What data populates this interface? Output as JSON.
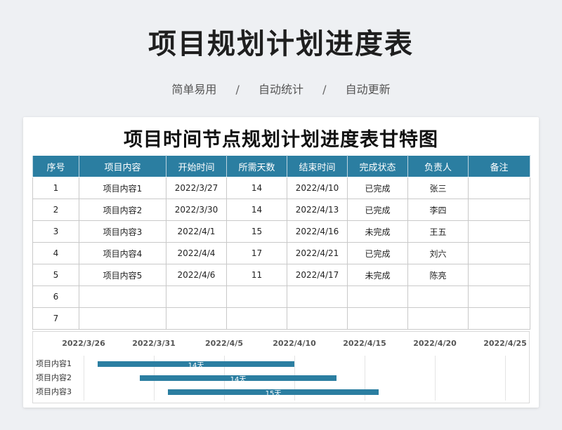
{
  "title": "项目规划计划进度表",
  "subtitle": [
    "简单易用",
    "自动统计",
    "自动更新"
  ],
  "separator": "/",
  "card_title": "项目时间节点规划计划进度表甘特图",
  "table": {
    "headers": [
      "序号",
      "项目内容",
      "开始时间",
      "所需天数",
      "结束时间",
      "完成状态",
      "负责人",
      "备注"
    ],
    "rows": [
      [
        "1",
        "项目内容1",
        "2022/3/27",
        "14",
        "2022/4/10",
        "已完成",
        "张三",
        ""
      ],
      [
        "2",
        "项目内容2",
        "2022/3/30",
        "14",
        "2022/4/13",
        "已完成",
        "李四",
        ""
      ],
      [
        "3",
        "项目内容3",
        "2022/4/1",
        "15",
        "2022/4/16",
        "未完成",
        "王五",
        ""
      ],
      [
        "4",
        "项目内容4",
        "2022/4/4",
        "17",
        "2022/4/21",
        "已完成",
        "刘六",
        ""
      ],
      [
        "5",
        "项目内容5",
        "2022/4/6",
        "11",
        "2022/4/17",
        "未完成",
        "陈亮",
        ""
      ],
      [
        "6",
        "",
        "",
        "",
        "",
        "",
        "",
        ""
      ],
      [
        "7",
        "",
        "",
        "",
        "",
        "",
        "",
        ""
      ]
    ]
  },
  "gantt": {
    "axis_dates": [
      "2022/3/26",
      "2022/3/31",
      "2022/4/5",
      "2022/4/10",
      "2022/4/15",
      "2022/4/20",
      "2022/4/25"
    ],
    "tasks": [
      {
        "name": "项目内容1",
        "start": "2022/3/27",
        "end": "2022/4/10",
        "label": "14天"
      },
      {
        "name": "项目内容2",
        "start": "2022/3/30",
        "end": "2022/4/13",
        "label": "14天"
      },
      {
        "name": "项目内容3",
        "start": "2022/4/1",
        "end": "2022/4/16",
        "label": "15天"
      }
    ],
    "bar_color": "#2b7ea1"
  }
}
